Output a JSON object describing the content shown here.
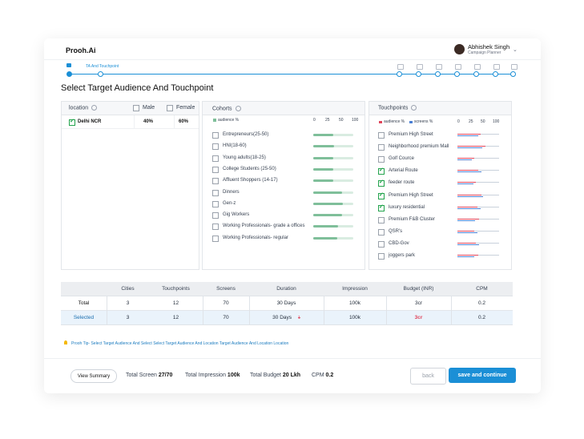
{
  "app": {
    "logo": "Prooh.Ai"
  },
  "user": {
    "name": "Abhishek Singh",
    "role": "Campaign Planner"
  },
  "stepper": {
    "current_label": "TA And Touchpoint"
  },
  "page_title": "Select Target Audience And Touchpoint",
  "location_panel": {
    "header": "location",
    "male_label": "Male",
    "female_label": "Female",
    "rows": [
      {
        "name": "Delhi NCR",
        "male": "40%",
        "female": "60%",
        "checked": true
      }
    ]
  },
  "cohorts_panel": {
    "header": "Cohorts",
    "legend": "audience %",
    "ticks": [
      "0",
      "25",
      "50",
      "100"
    ],
    "items": [
      {
        "label": "Entrepreneurs(25-50)",
        "value": 50
      },
      {
        "label": "HNI(18-60)",
        "value": 52
      },
      {
        "label": "Young adults(18-25)",
        "value": 50
      },
      {
        "label": "College Students (25-50)",
        "value": 50
      },
      {
        "label": "Affluent Shoppers (14-17)",
        "value": 50
      },
      {
        "label": "Dinners",
        "value": 72
      },
      {
        "label": "Gen-z",
        "value": 73
      },
      {
        "label": "Gig Workers",
        "value": 72
      },
      {
        "label": "Working Professionals- grade  a offices",
        "value": 62
      },
      {
        "label": "Working Professionals- regular",
        "value": 60
      }
    ]
  },
  "touchpoints_panel": {
    "header": "Touchpoints",
    "legend_audience": "audience %",
    "legend_screens": "screens %",
    "ticks": [
      "0",
      "25",
      "50",
      "100"
    ],
    "colors": {
      "audience": "#e0445a",
      "screens": "#4a7fd4"
    },
    "items": [
      {
        "label": "Premium High Street",
        "checked": false,
        "audience": 55,
        "screens": 50
      },
      {
        "label": "Neighborhood premium Mall",
        "checked": false,
        "audience": 68,
        "screens": 60
      },
      {
        "label": "Golf Cource",
        "checked": false,
        "audience": 40,
        "screens": 35
      },
      {
        "label": "Arterial Route",
        "checked": true,
        "audience": 50,
        "screens": 58
      },
      {
        "label": "feeder route",
        "checked": true,
        "audience": 45,
        "screens": 38
      },
      {
        "label": "Premium High Street",
        "checked": true,
        "audience": 58,
        "screens": 62
      },
      {
        "label": "luxury residential",
        "checked": true,
        "audience": 48,
        "screens": 55
      },
      {
        "label": "Premium F&B Cluster",
        "checked": false,
        "audience": 52,
        "screens": 42
      },
      {
        "label": "QSR's",
        "checked": false,
        "audience": 40,
        "screens": 48
      },
      {
        "label": "CBD-Gov",
        "checked": false,
        "audience": 45,
        "screens": 52
      },
      {
        "label": "joggers park",
        "checked": false,
        "audience": 50,
        "screens": 40
      }
    ]
  },
  "summary_table": {
    "columns": [
      "Cities",
      "Touchpoints",
      "Screens",
      "Duration",
      "Impression",
      "Budget (INR)",
      "CPM"
    ],
    "rows": [
      {
        "label": "Total",
        "cells": [
          "3",
          "12",
          "70",
          "30 Days",
          "100k",
          "3cr",
          "0.2"
        ]
      },
      {
        "label": "Selected",
        "cells": [
          "3",
          "12",
          "70",
          "30 Days",
          "100k",
          "3cr",
          "0.2"
        ],
        "duration_strike": "1"
      }
    ]
  },
  "tip": "Prooh Tip-  Select Target Audience And Select Select Target Audience And Location Target Audience And Location Location",
  "footer": {
    "view_summary": "View Summary",
    "total_screen_label": "Total Screen",
    "total_screen_value": "27/70",
    "total_impression_label": "Total Impression",
    "total_impression_value": "100k",
    "total_budget_label": "Total Budget",
    "total_budget_value": "20 Lkh",
    "cpm_label": "CPM",
    "cpm_value": "0.2",
    "back_label": "back",
    "save_label": "save and continue"
  }
}
